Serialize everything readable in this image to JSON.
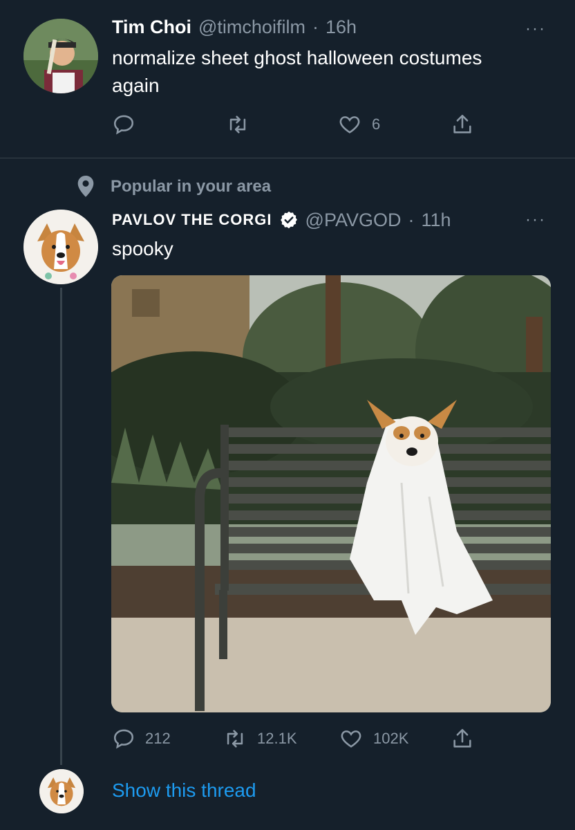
{
  "tweet1": {
    "display_name": "Tim Choi",
    "handle": "@timchoifilm",
    "separator": "·",
    "time": "16h",
    "text_line1": "normalize sheet ghost halloween costumes",
    "text_line2": "again",
    "like_count": "6",
    "more": "···"
  },
  "social_context": {
    "label": "Popular in your area"
  },
  "tweet2": {
    "display_name": "PAVLOV THE CORGI",
    "handle": "@PAVGOD",
    "separator": "·",
    "time": "11h",
    "text": "spooky",
    "reply_count": "212",
    "retweet_count": "12.1K",
    "like_count": "102K",
    "more": "···"
  },
  "thread": {
    "show_label": "Show this thread"
  },
  "colors": {
    "background": "#15202b",
    "secondary_text": "#8b98a5",
    "link": "#1d9bf0",
    "thread_line": "#38444d"
  }
}
